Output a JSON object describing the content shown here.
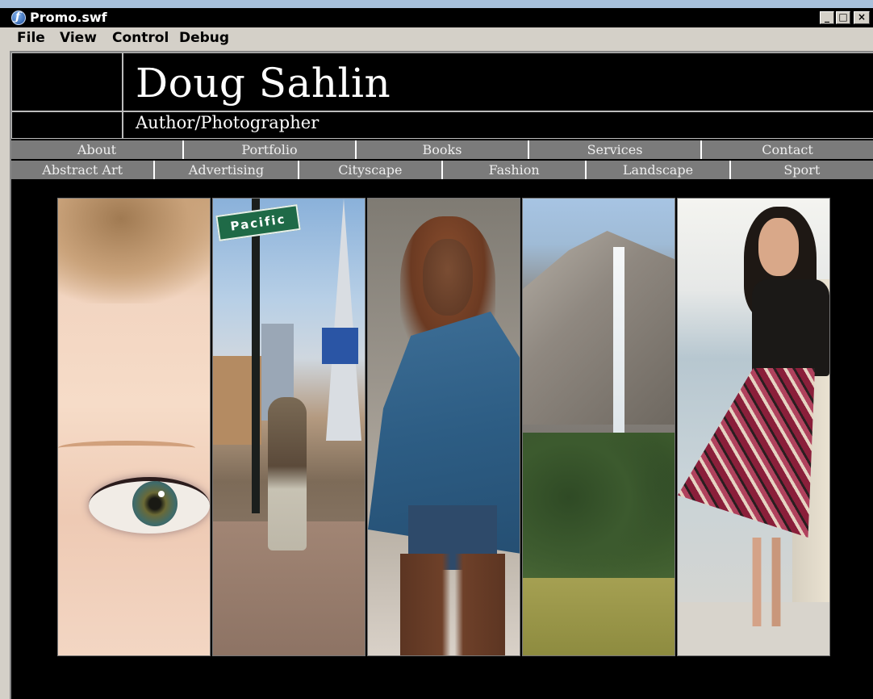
{
  "window": {
    "title": "Promo.swf",
    "controls": {
      "minimize": "_",
      "maximize": "□",
      "close": "×"
    }
  },
  "menubar": {
    "items": [
      "File",
      "View",
      "Control",
      "Debug"
    ]
  },
  "site": {
    "name": "Doug Sahlin",
    "tagline": "Author/Photographer"
  },
  "nav": {
    "primary": [
      "About",
      "Portfolio",
      "Books",
      "Services",
      "Contact"
    ],
    "secondary": [
      "Abstract Art",
      "Advertising",
      "Cityscape",
      "Fashion",
      "Landscape",
      "Sport"
    ]
  },
  "gallery": {
    "street_sign": "Pacific"
  },
  "colors": {
    "stage_background": "#000000",
    "nav_button": "#7b7b7b",
    "nav_text": "#eeeeee",
    "chrome": "#d4d0c8"
  },
  "icons": {
    "title": "flash-player-icon"
  }
}
